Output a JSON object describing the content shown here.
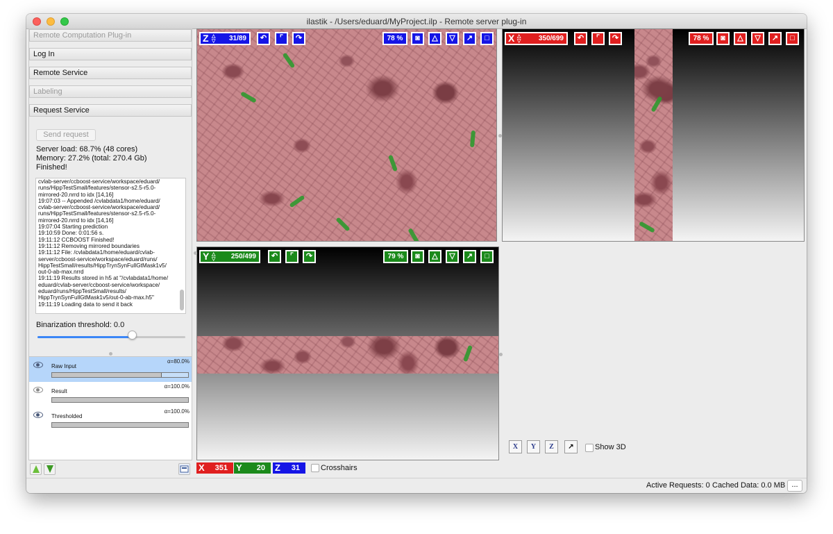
{
  "window": {
    "title": "ilastik - /Users/eduard/MyProject.ilp - Remote server plug-in"
  },
  "sidebar": {
    "sections": [
      {
        "label": "Remote Computation Plug-in",
        "enabled": false
      },
      {
        "label": "Log In",
        "enabled": true
      },
      {
        "label": "Remote Service",
        "enabled": true
      },
      {
        "label": "Labeling",
        "enabled": false
      },
      {
        "label": "Request Service",
        "enabled": true
      }
    ],
    "send_button": "Send request",
    "server_load": "Server load: 68.7% (48 cores)",
    "memory": "Memory: 27.2% (total: 270.4 Gb)",
    "state": "Finished!",
    "log": "cvlab-server/ccboost-service/workspace/eduard/\nruns/HippTestSmall/features/stensor-s2.5-r5.0-\nmirrored-20.nrrd to idx [14,16]\n19:07:03 -- Appended /cvlabdata1/home/eduard/\ncvlab-server/ccboost-service/workspace/eduard/\nruns/HippTestSmall/features/stensor-s2.5-r5.0-\nmirrored-20.nrrd to idx [14,16]\n19:07:04 Starting prediction\n19:10:59 Done: 0:01:56 s.\n19:11:12 CCBOOST Finished!\n19:11:12 Removing mirrored boundaries\n19:11:12 File: /cvlabdata1/home/eduard/cvlab-\nserver/ccboost-service/workspace/eduard/runs/\nHippTestSmall/results/HippTrynSynFullGtMask1v5/\nout-0-ab-max.nrrd\n19:11:19 Results stored in h5 at \"/cvlabdata1/home/\neduard/cvlab-server/ccboost-service/workspace/\neduard/runs/HippTestSmall/results/\nHippTrynSynFullGtMask1v5/out-0-ab-max.h5\"\n19:11:19 Loading data to send it back",
    "threshold_label": "Binarization threshold: 0.0",
    "threshold_fraction": 0.64
  },
  "layers": [
    {
      "name": "Raw Input",
      "alpha": "α=80.0%",
      "opacity": 0.8,
      "selected": true,
      "visible": true
    },
    {
      "name": "Result",
      "alpha": "α=100.0%",
      "opacity": 1.0,
      "selected": false,
      "visible": false
    },
    {
      "name": "Thresholded",
      "alpha": "α=100.0%",
      "opacity": 1.0,
      "selected": false,
      "visible": true
    }
  ],
  "viewers": {
    "z": {
      "axis": "Z",
      "slice": "31/89",
      "zoom": "78 %",
      "color": "#1515e6"
    },
    "x": {
      "axis": "X",
      "slice": "350/699",
      "zoom": "78 %",
      "color": "#e01f1f"
    },
    "y": {
      "axis": "Y",
      "slice": "250/499",
      "zoom": "79 %",
      "color": "#1b8a1b"
    }
  },
  "coordinates": {
    "x_label": "X",
    "x_value": "351",
    "y_label": "Y",
    "y_value": "20",
    "z_label": "Z",
    "z_value": "31"
  },
  "crosshairs_label": "Crosshairs",
  "view3d": {
    "buttons": [
      "X",
      "Y",
      "Z",
      "↗"
    ],
    "show_3d_label": "Show 3D"
  },
  "statusbar": {
    "active_requests": "Active Requests: 0",
    "cached_data": "Cached Data: 0.0 MB",
    "more": "..."
  }
}
